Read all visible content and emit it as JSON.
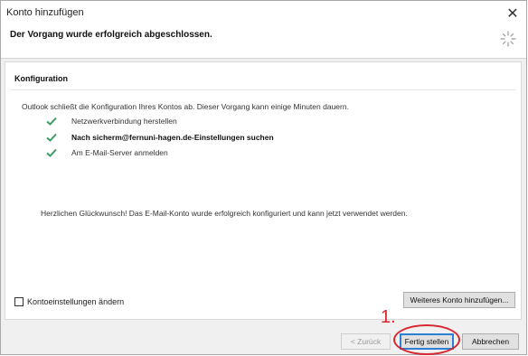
{
  "window": {
    "title": "Konto hinzufügen",
    "close_label": "✕"
  },
  "header": {
    "message": "Der Vorgang wurde erfolgreich abgeschlossen."
  },
  "section": {
    "title": "Konfiguration",
    "intro": "Outlook schließt die Konfiguration Ihres Kontos ab. Dieser Vorgang kann einige Minuten dauern.",
    "steps": [
      {
        "label": "Netzwerkverbindung herstellen"
      },
      {
        "label": "Nach sicherm@fernuni-hagen.de-Einstellungen suchen"
      },
      {
        "label": "Am E-Mail-Server anmelden"
      }
    ],
    "congrats": "Herzlichen Glückwunsch! Das E-Mail-Konto wurde erfolgreich konfiguriert und kann jetzt verwendet werden."
  },
  "footer": {
    "checkbox_label": "Kontoeinstellungen ändern",
    "more_account_label": "Weiteres Konto hinzufügen...",
    "back_label": "< Zurück",
    "finish_label": "Fertig stellen",
    "cancel_label": "Abbrechen"
  },
  "annotation": {
    "number": "1."
  },
  "colors": {
    "check_green": "#3c9c63",
    "annotation_red": "#d8262f",
    "focus_blue": "#2d7fd6"
  }
}
